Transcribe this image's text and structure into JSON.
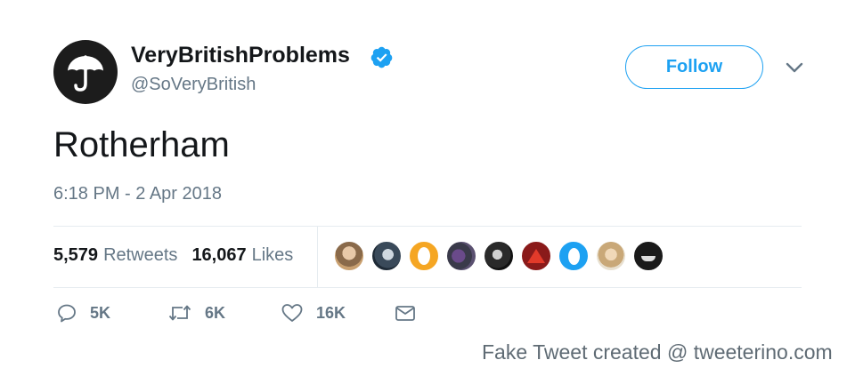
{
  "author": {
    "display_name": "VeryBritishProblems",
    "handle": "@SoVeryBritish",
    "verified": true,
    "avatar_icon": "umbrella-icon"
  },
  "follow_label": "Follow",
  "tweet": {
    "text": "Rotherham",
    "timestamp": "6:18 PM - 2 Apr 2018"
  },
  "stats": {
    "retweets": {
      "count": "5,579",
      "label": "Retweets"
    },
    "likes": {
      "count": "16,067",
      "label": "Likes"
    }
  },
  "actions": {
    "reply_count": "5K",
    "retweet_count": "6K",
    "like_count": "16K"
  },
  "watermark": "Fake Tweet created @ tweeterino.com",
  "colors": {
    "accent": "#1da1f2",
    "text": "#14171a",
    "secondary": "#657786",
    "divider": "#e6ecf0"
  }
}
